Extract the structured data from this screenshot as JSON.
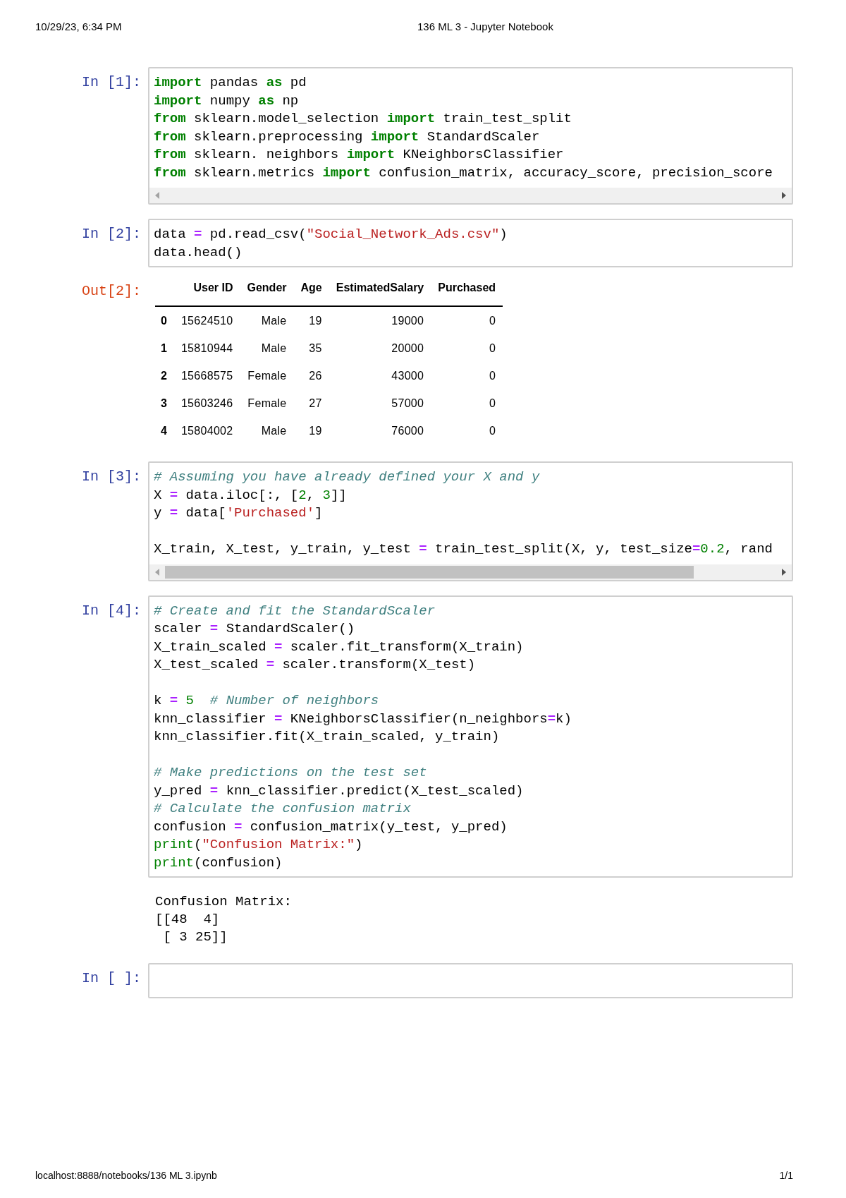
{
  "header": {
    "date": "10/29/23, 6:34 PM",
    "title": "136 ML 3 - Jupyter Notebook"
  },
  "cells": [
    {
      "prompt": "In [1]:",
      "horizontal_scrollbar": true,
      "scrollbar_thumb": false,
      "lines": [
        {
          "tokens": [
            {
              "kind": "kw",
              "text": "import"
            },
            {
              "kind": "plain",
              "text": " pandas "
            },
            {
              "kind": "kw",
              "text": "as"
            },
            {
              "kind": "plain",
              "text": " pd"
            }
          ]
        },
        {
          "tokens": [
            {
              "kind": "kw",
              "text": "import"
            },
            {
              "kind": "plain",
              "text": " numpy "
            },
            {
              "kind": "kw",
              "text": "as"
            },
            {
              "kind": "plain",
              "text": " np"
            }
          ]
        },
        {
          "tokens": [
            {
              "kind": "kw",
              "text": "from"
            },
            {
              "kind": "plain",
              "text": " sklearn.model_selection "
            },
            {
              "kind": "kw",
              "text": "import"
            },
            {
              "kind": "plain",
              "text": " train_test_split"
            }
          ]
        },
        {
          "tokens": [
            {
              "kind": "kw",
              "text": "from"
            },
            {
              "kind": "plain",
              "text": " sklearn.preprocessing "
            },
            {
              "kind": "kw",
              "text": "import"
            },
            {
              "kind": "plain",
              "text": " StandardScaler"
            }
          ]
        },
        {
          "tokens": [
            {
              "kind": "kw",
              "text": "from"
            },
            {
              "kind": "plain",
              "text": " sklearn. neighbors "
            },
            {
              "kind": "kw",
              "text": "import"
            },
            {
              "kind": "plain",
              "text": " KNeighborsClassifier"
            }
          ]
        },
        {
          "tokens": [
            {
              "kind": "kw",
              "text": "from"
            },
            {
              "kind": "plain",
              "text": " sklearn.metrics "
            },
            {
              "kind": "kw",
              "text": "import"
            },
            {
              "kind": "plain",
              "text": " confusion_matrix, accuracy_score, precision_score"
            }
          ]
        }
      ]
    },
    {
      "prompt": "In [2]:",
      "horizontal_scrollbar": false,
      "lines": [
        {
          "tokens": [
            {
              "kind": "plain",
              "text": "data "
            },
            {
              "kind": "op",
              "text": "="
            },
            {
              "kind": "plain",
              "text": " pd.read_csv("
            },
            {
              "kind": "str",
              "text": "\"Social_Network_Ads.csv\""
            },
            {
              "kind": "plain",
              "text": ")"
            }
          ]
        },
        {
          "tokens": [
            {
              "kind": "plain",
              "text": "data.head()"
            }
          ]
        }
      ],
      "output": {
        "prompt": "Out[2]:",
        "kind": "table",
        "table": {
          "columns": [
            "User ID",
            "Gender",
            "Age",
            "EstimatedSalary",
            "Purchased"
          ],
          "rows": [
            {
              "index": "0",
              "cells": [
                "15624510",
                "Male",
                "19",
                "19000",
                "0"
              ]
            },
            {
              "index": "1",
              "cells": [
                "15810944",
                "Male",
                "35",
                "20000",
                "0"
              ]
            },
            {
              "index": "2",
              "cells": [
                "15668575",
                "Female",
                "26",
                "43000",
                "0"
              ]
            },
            {
              "index": "3",
              "cells": [
                "15603246",
                "Female",
                "27",
                "57000",
                "0"
              ]
            },
            {
              "index": "4",
              "cells": [
                "15804002",
                "Male",
                "19",
                "76000",
                "0"
              ]
            }
          ]
        }
      }
    },
    {
      "prompt": "In [3]:",
      "horizontal_scrollbar": true,
      "scrollbar_thumb": true,
      "lines": [
        {
          "tokens": [
            {
              "kind": "com",
              "text": "# Assuming you have already defined your X and y"
            }
          ]
        },
        {
          "tokens": [
            {
              "kind": "plain",
              "text": "X "
            },
            {
              "kind": "op",
              "text": "="
            },
            {
              "kind": "plain",
              "text": " data.iloc[:, ["
            },
            {
              "kind": "num",
              "text": "2"
            },
            {
              "kind": "plain",
              "text": ", "
            },
            {
              "kind": "num",
              "text": "3"
            },
            {
              "kind": "plain",
              "text": "]]"
            }
          ]
        },
        {
          "tokens": [
            {
              "kind": "plain",
              "text": "y "
            },
            {
              "kind": "op",
              "text": "="
            },
            {
              "kind": "plain",
              "text": " data["
            },
            {
              "kind": "str",
              "text": "'Purchased'"
            },
            {
              "kind": "plain",
              "text": "]"
            }
          ]
        },
        {
          "kind": "blank"
        },
        {
          "tokens": [
            {
              "kind": "plain",
              "text": "X_train, X_test, y_train, y_test "
            },
            {
              "kind": "op",
              "text": "="
            },
            {
              "kind": "plain",
              "text": " train_test_split(X, y, test_size"
            },
            {
              "kind": "op",
              "text": "="
            },
            {
              "kind": "num",
              "text": "0.2"
            },
            {
              "kind": "plain",
              "text": ", rand"
            }
          ]
        }
      ]
    },
    {
      "prompt": "In [4]:",
      "horizontal_scrollbar": false,
      "lines": [
        {
          "tokens": [
            {
              "kind": "com",
              "text": "# Create and fit the StandardScaler"
            }
          ]
        },
        {
          "tokens": [
            {
              "kind": "plain",
              "text": "scaler "
            },
            {
              "kind": "op",
              "text": "="
            },
            {
              "kind": "plain",
              "text": " StandardScaler()"
            }
          ]
        },
        {
          "tokens": [
            {
              "kind": "plain",
              "text": "X_train_scaled "
            },
            {
              "kind": "op",
              "text": "="
            },
            {
              "kind": "plain",
              "text": " scaler.fit_transform(X_train)"
            }
          ]
        },
        {
          "tokens": [
            {
              "kind": "plain",
              "text": "X_test_scaled "
            },
            {
              "kind": "op",
              "text": "="
            },
            {
              "kind": "plain",
              "text": " scaler.transform(X_test)"
            }
          ]
        },
        {
          "kind": "blank"
        },
        {
          "tokens": [
            {
              "kind": "plain",
              "text": "k "
            },
            {
              "kind": "op",
              "text": "="
            },
            {
              "kind": "num",
              "text": " 5"
            },
            {
              "kind": "com",
              "text": "  # Number of neighbors"
            }
          ]
        },
        {
          "tokens": [
            {
              "kind": "plain",
              "text": "knn_classifier "
            },
            {
              "kind": "op",
              "text": "="
            },
            {
              "kind": "plain",
              "text": " KNeighborsClassifier(n_neighbors"
            },
            {
              "kind": "op",
              "text": "="
            },
            {
              "kind": "plain",
              "text": "k)"
            }
          ]
        },
        {
          "tokens": [
            {
              "kind": "plain",
              "text": "knn_classifier.fit(X_train_scaled, y_train)"
            }
          ]
        },
        {
          "kind": "blank"
        },
        {
          "tokens": [
            {
              "kind": "com",
              "text": "# Make predictions on the test set"
            }
          ]
        },
        {
          "tokens": [
            {
              "kind": "plain",
              "text": "y_pred "
            },
            {
              "kind": "op",
              "text": "="
            },
            {
              "kind": "plain",
              "text": " knn_classifier.predict(X_test_scaled)"
            }
          ]
        },
        {
          "tokens": [
            {
              "kind": "com",
              "text": "# Calculate the confusion matrix"
            }
          ]
        },
        {
          "tokens": [
            {
              "kind": "plain",
              "text": "confusion "
            },
            {
              "kind": "op",
              "text": "="
            },
            {
              "kind": "plain",
              "text": " confusion_matrix(y_test, y_pred)"
            }
          ]
        },
        {
          "tokens": [
            {
              "kind": "builtin",
              "text": "print"
            },
            {
              "kind": "plain",
              "text": "("
            },
            {
              "kind": "str",
              "text": "\"Confusion Matrix:\""
            },
            {
              "kind": "plain",
              "text": ")"
            }
          ]
        },
        {
          "tokens": [
            {
              "kind": "builtin",
              "text": "print"
            },
            {
              "kind": "plain",
              "text": "(confusion)"
            }
          ]
        }
      ],
      "output": {
        "kind": "stream",
        "lines": [
          "Confusion Matrix:",
          "[[48  4]",
          " [ 3 25]]"
        ]
      }
    },
    {
      "prompt": "In [ ]:",
      "horizontal_scrollbar": false
    }
  ],
  "footer": {
    "url": "localhost:8888/notebooks/136 ML 3.ipynb",
    "page": "1/1"
  }
}
